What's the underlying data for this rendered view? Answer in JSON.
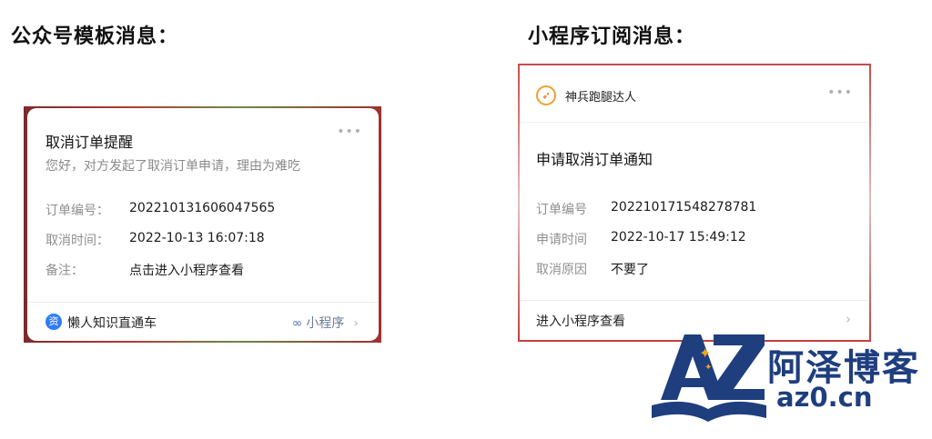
{
  "left_section": {
    "title": "公众号模板消息：",
    "card": {
      "title": "取消订单提醒",
      "subtitle": "您好，对方发起了取消订单申请，理由为难吃",
      "more": "•••",
      "rows": [
        {
          "label": "订单编号：",
          "value": "202210131606047565"
        },
        {
          "label": "取消时间：",
          "value": "2022-10-13 16:07:18"
        },
        {
          "label": "备注：",
          "value": "点击进入小程序查看"
        }
      ],
      "footer": {
        "account_icon_glyph": "资",
        "account_name": "懒人知识直通车",
        "mini_program_label": "小程序",
        "chevron": "›"
      }
    }
  },
  "right_section": {
    "title": "小程序订阅消息：",
    "card": {
      "brand_name": "神兵跑腿达人",
      "more": "•••",
      "title": "申请取消订单通知",
      "rows": [
        {
          "label": "订单编号",
          "value": "202210171548278781"
        },
        {
          "label": "申请时间",
          "value": "2022-10-17 15:49:12"
        },
        {
          "label": "取消原因",
          "value": "不要了"
        }
      ],
      "footer": {
        "enter_label": "进入小程序查看",
        "chevron": "›"
      }
    }
  },
  "watermark": {
    "logo_letters": "AZ",
    "name_cn": "阿泽博客",
    "url": "az0.cn"
  },
  "colors": {
    "accent_blue": "#2f7cf6",
    "watermark_navy": "#1e3e7e",
    "label_gray": "#8f8f8f"
  }
}
